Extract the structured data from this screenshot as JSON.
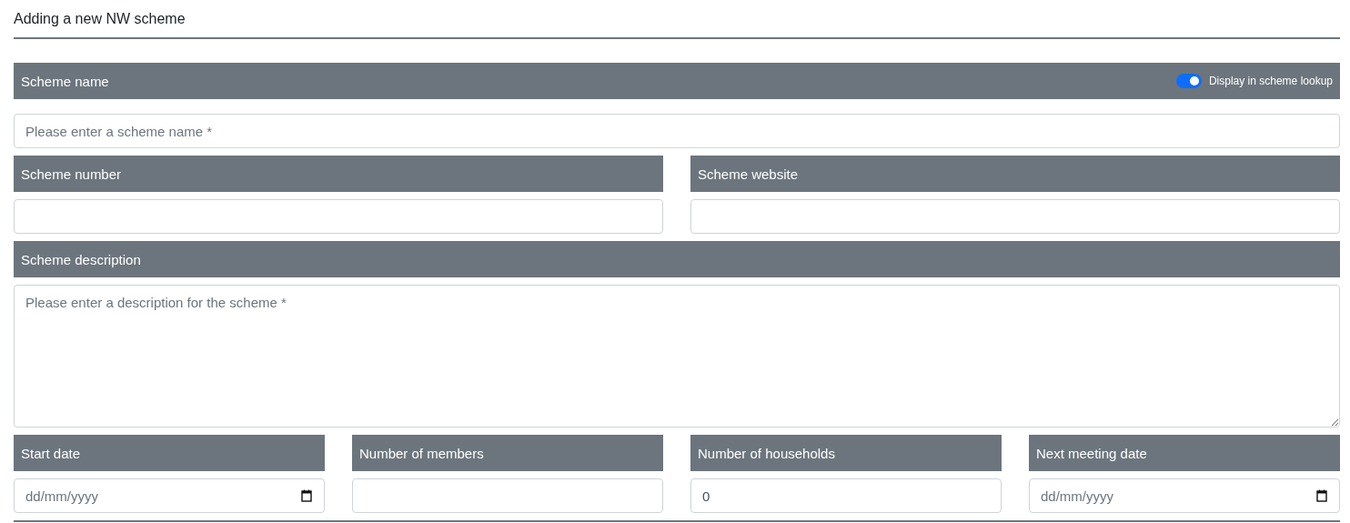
{
  "title": "Adding a new NW scheme",
  "rows": [
    [
      {
        "label": "Scheme name",
        "toggle": {
          "label": "Display in scheme lookup",
          "on": true
        },
        "kind": "text",
        "placeholder": "Please enter a scheme name *"
      }
    ],
    [
      {
        "label": "Scheme number",
        "kind": "text"
      },
      {
        "label": "Scheme website",
        "kind": "text"
      }
    ],
    [
      {
        "label": "Scheme description",
        "kind": "textarea",
        "placeholder": "Please enter a description for the scheme *"
      }
    ],
    [
      {
        "label": "Start date",
        "kind": "date",
        "placeholder": "dd/mm/yyyy"
      },
      {
        "label": "Number of members",
        "kind": "text"
      },
      {
        "label": "Number of households",
        "kind": "text",
        "value": "0"
      },
      {
        "label": "Next meeting date",
        "kind": "date",
        "placeholder": "dd/mm/yyyy"
      }
    ]
  ]
}
